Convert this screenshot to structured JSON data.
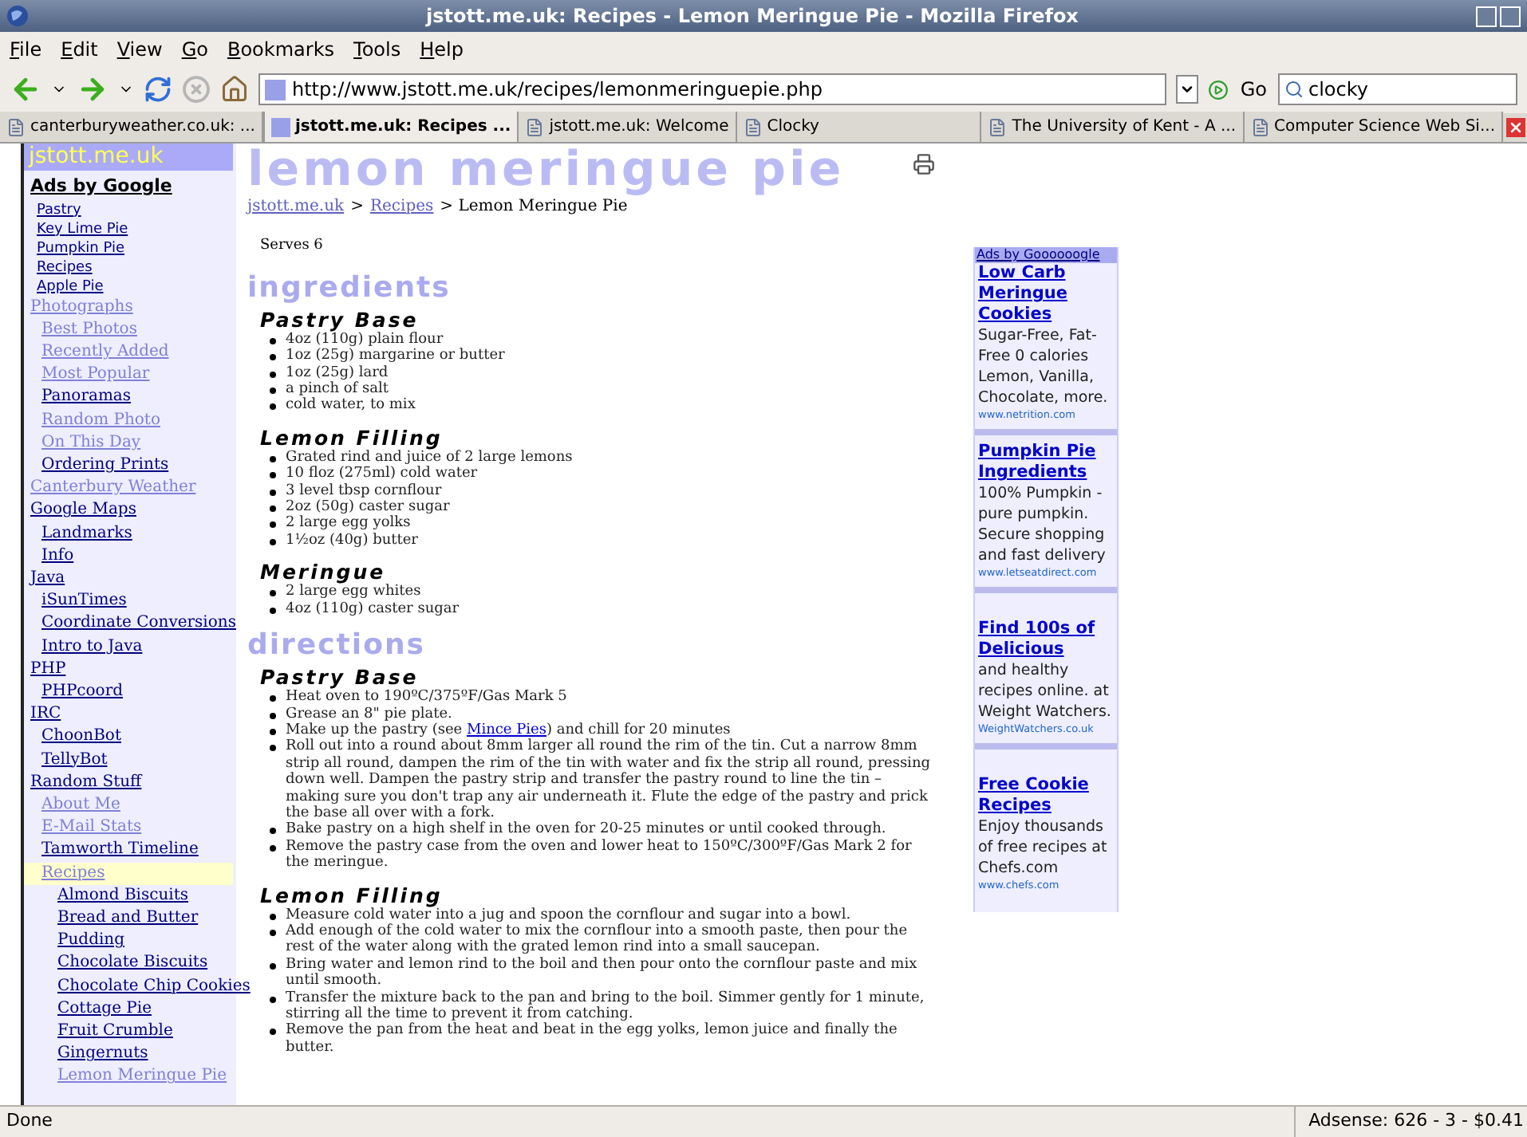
{
  "window": {
    "title": "jstott.me.uk: Recipes - Lemon Meringue Pie - Mozilla Firefox"
  },
  "menu": [
    "File",
    "Edit",
    "View",
    "Go",
    "Bookmarks",
    "Tools",
    "Help"
  ],
  "toolbar": {
    "url": "http://www.jstott.me.uk/recipes/lemonmeringuepie.php",
    "go": "Go",
    "search": "clocky"
  },
  "tabs": [
    {
      "label": "canterburyweather.co.uk: ...",
      "selected": false
    },
    {
      "label": "jstott.me.uk: Recipes ...",
      "selected": true
    },
    {
      "label": "jstott.me.uk: Welcome",
      "selected": false
    },
    {
      "label": "Clocky",
      "selected": false
    },
    {
      "label": "The University of Kent - A ...",
      "selected": false
    },
    {
      "label": "Computer Science Web Si...",
      "selected": false
    }
  ],
  "sidebar": {
    "site": "jstott.me.uk",
    "ads_title": "Ads by Google",
    "ad_links": [
      "Pastry",
      "Key Lime Pie",
      "Pumpkin Pie",
      "Recipes",
      "Apple Pie"
    ],
    "nav": [
      {
        "label": "Photographs",
        "visited": true,
        "selected": false,
        "children": [
          {
            "label": "Best Photos",
            "visited": true,
            "selected": false
          },
          {
            "label": "Recently Added",
            "visited": true,
            "selected": false
          },
          {
            "label": "Most Popular",
            "visited": true,
            "selected": false
          },
          {
            "label": "Panoramas",
            "visited": false,
            "selected": false
          },
          {
            "label": "Random Photo",
            "visited": true,
            "selected": false
          },
          {
            "label": "On This Day",
            "visited": true,
            "selected": false
          },
          {
            "label": "Ordering Prints",
            "visited": false,
            "selected": false
          }
        ]
      },
      {
        "label": "Canterbury Weather",
        "visited": true,
        "selected": false
      },
      {
        "label": "Google Maps",
        "visited": false,
        "selected": false,
        "children": [
          {
            "label": "Landmarks",
            "visited": false,
            "selected": false
          },
          {
            "label": "Info",
            "visited": false,
            "selected": false
          }
        ]
      },
      {
        "label": "Java",
        "visited": false,
        "selected": false,
        "children": [
          {
            "label": "iSunTimes",
            "visited": false,
            "selected": false
          },
          {
            "label": "Coordinate Conversions",
            "visited": false,
            "selected": false
          },
          {
            "label": "Intro to Java",
            "visited": false,
            "selected": false
          }
        ]
      },
      {
        "label": "PHP",
        "visited": false,
        "selected": false,
        "children": [
          {
            "label": "PHPcoord",
            "visited": false,
            "selected": false
          }
        ]
      },
      {
        "label": "IRC",
        "visited": false,
        "selected": false,
        "children": [
          {
            "label": "ChoonBot",
            "visited": false,
            "selected": false
          },
          {
            "label": "TellyBot",
            "visited": false,
            "selected": false
          }
        ]
      },
      {
        "label": "Random Stuff",
        "visited": false,
        "selected": false,
        "children": [
          {
            "label": "About Me",
            "visited": true,
            "selected": false
          },
          {
            "label": "E-Mail Stats",
            "visited": true,
            "selected": false
          },
          {
            "label": "Tamworth Timeline",
            "visited": false,
            "selected": false
          },
          {
            "label": "Recipes",
            "visited": true,
            "selected": true,
            "children": [
              {
                "label": "Almond Biscuits",
                "visited": false,
                "selected": false
              },
              {
                "label": "Bread and Butter",
                "visited": false,
                "selected": false
              },
              {
                "label": "Pudding",
                "visited": false,
                "selected": false
              },
              {
                "label": "Chocolate Biscuits",
                "visited": false,
                "selected": false
              },
              {
                "label": "Chocolate Chip Cookies",
                "visited": false,
                "selected": false
              },
              {
                "label": "Cottage Pie",
                "visited": false,
                "selected": false
              },
              {
                "label": "Fruit Crumble",
                "visited": false,
                "selected": false
              },
              {
                "label": "Gingernuts",
                "visited": false,
                "selected": false
              },
              {
                "label": "Lemon Meringue Pie",
                "visited": true,
                "selected": false
              }
            ]
          }
        ]
      }
    ]
  },
  "page": {
    "title": "lemon meringue pie",
    "breadcrumb": [
      {
        "kind": "link",
        "text": "jstott.me.uk"
      },
      {
        "kind": "text",
        "text": ">"
      },
      {
        "kind": "link",
        "text": "Recipes"
      },
      {
        "kind": "text",
        "text": "> Lemon Meringue Pie"
      }
    ],
    "serves": "Serves 6",
    "sections": [
      {
        "heading": "ingredients",
        "groups": [
          {
            "heading": "Pastry Base",
            "items": [
              "4oz (110g) plain flour",
              "1oz (25g) margarine or butter",
              "1oz (25g) lard",
              "a pinch of salt",
              "cold water, to mix"
            ]
          },
          {
            "heading": "Lemon Filling",
            "items": [
              "Grated rind and juice of 2 large lemons",
              "10 floz (275ml) cold water",
              "3 level tbsp cornflour",
              "2oz (50g) caster sugar",
              "2 large egg yolks",
              "1½oz (40g) butter"
            ]
          },
          {
            "heading": "Meringue",
            "items": [
              "2 large egg whites",
              "4oz (110g) caster sugar"
            ]
          }
        ]
      },
      {
        "heading": "directions",
        "groups": [
          {
            "heading": "Pastry Base",
            "items": [
              "Heat oven to 190ºC/375ºF/Gas Mark 5",
              "Grease an 8\" pie plate.",
              [
                {
                  "kind": "text",
                  "text": "Make up the pastry (see "
                },
                {
                  "kind": "link",
                  "text": "Mince Pies"
                },
                {
                  "kind": "text",
                  "text": ") and chill for 20 minutes"
                }
              ],
              "Roll out into a round about 8mm larger all round the rim of the tin. Cut a narrow 8mm strip all round, dampen the rim of the tin with water and fix the strip all round, pressing down well. Dampen the pastry strip and transfer the pastry round to line the tin – making sure you don't trap any air underneath it. Flute the edge of the pastry and prick the base all over with a fork.",
              "Bake pastry on a high shelf in the oven for 20-25 minutes or until cooked through.",
              "Remove the pastry case from the oven and lower heat to 150ºC/300ºF/Gas Mark 2 for the meringue."
            ]
          },
          {
            "heading": "Lemon Filling",
            "items": [
              "Measure cold water into a jug and spoon the cornflour and sugar into a bowl.",
              "Add enough of the cold water to mix the cornflour into a smooth paste, then pour the rest of the water along with the grated lemon rind into a small saucepan.",
              "Bring water and lemon rind to the boil and then pour onto the cornflour paste and mix until smooth.",
              "Transfer the mixture back to the pan and bring to the boil. Simmer gently for 1 minute, stirring all the time to prevent it from catching.",
              "Remove the pan from the heat and beat in the egg yolks, lemon juice and finally the butter."
            ]
          }
        ]
      }
    ]
  },
  "ads": {
    "title": "Ads by Goooooogle",
    "items": [
      {
        "title": "Low Carb Meringue Cookies",
        "body": "Sugar-Free, Fat-Free 0 calories Lemon, Vanilla, Chocolate, more.",
        "url": "www.netrition.com"
      },
      {
        "title": "Pumpkin Pie Ingredients",
        "body": "100% Pumpkin - pure pumpkin. Secure shopping and fast delivery",
        "url": "www.letseatdirect.com"
      },
      {
        "title": "Find 100s of Delicious",
        "body": "and healthy recipes online. at Weight Watchers.",
        "url": "WeightWatchers.co.uk"
      },
      {
        "title": "Free Cookie Recipes",
        "body": "Enjoy thousands of free recipes at Chefs.com",
        "url": "www.chefs.com"
      }
    ]
  },
  "status_bar": {
    "left": "Done",
    "right": "Adsense: 626 - 3 - $0.41"
  }
}
